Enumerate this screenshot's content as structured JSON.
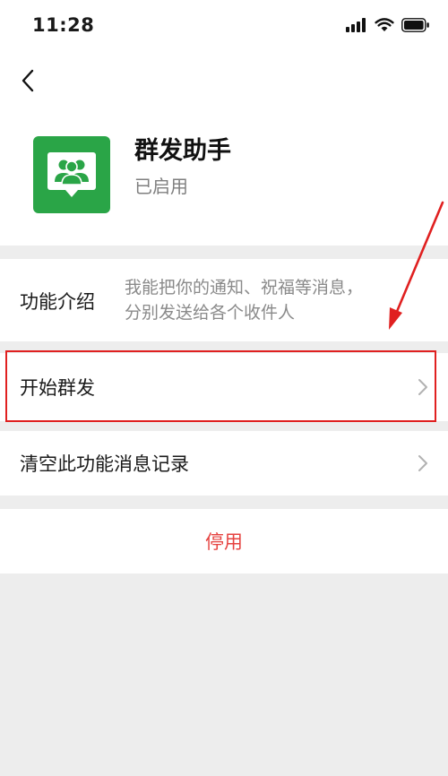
{
  "status_bar": {
    "time": "11:28"
  },
  "header": {
    "title": "群发助手",
    "status": "已启用"
  },
  "intro": {
    "label": "功能介绍",
    "description": "我能把你的通知、祝福等消息，\n分别发送给各个收件人"
  },
  "rows": [
    {
      "label": "开始群发"
    },
    {
      "label": "清空此功能消息记录"
    }
  ],
  "disable_label": "停用",
  "colors": {
    "accent_green": "#2aa547",
    "danger_red": "#e64340",
    "annotation_red": "#e02020"
  }
}
